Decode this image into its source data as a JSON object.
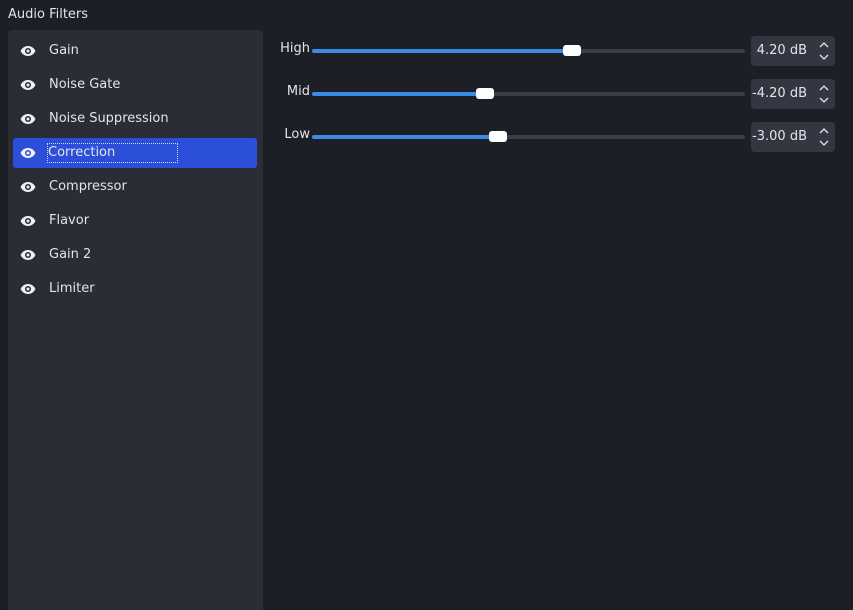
{
  "panel": {
    "title": "Audio Filters"
  },
  "filters": [
    {
      "label": "Gain",
      "selected": false
    },
    {
      "label": "Noise Gate",
      "selected": false
    },
    {
      "label": "Noise Suppression",
      "selected": false
    },
    {
      "label": "Correction",
      "selected": true
    },
    {
      "label": "Compressor",
      "selected": false
    },
    {
      "label": "Flavor",
      "selected": false
    },
    {
      "label": "Gain 2",
      "selected": false
    },
    {
      "label": "Limiter",
      "selected": false
    }
  ],
  "properties": [
    {
      "label": "High",
      "value_text": "4.20 dB",
      "value": 4.2,
      "slider_fraction": 0.6
    },
    {
      "label": "Mid",
      "value_text": "-4.20 dB",
      "value": -4.2,
      "slider_fraction": 0.4
    },
    {
      "label": "Low",
      "value_text": "-3.00 dB",
      "value": -3.0,
      "slider_fraction": 0.43
    }
  ],
  "colors": {
    "background": "#1d1f26",
    "list_background": "#2a2c36",
    "selection": "#2b4fd9",
    "slider_fill": "#3a8ae8",
    "slider_track": "#3b3e49",
    "spinbox": "#343742"
  },
  "icons": {
    "visibility": "eye-icon",
    "increment": "chevron-up-icon",
    "decrement": "chevron-down-icon"
  }
}
